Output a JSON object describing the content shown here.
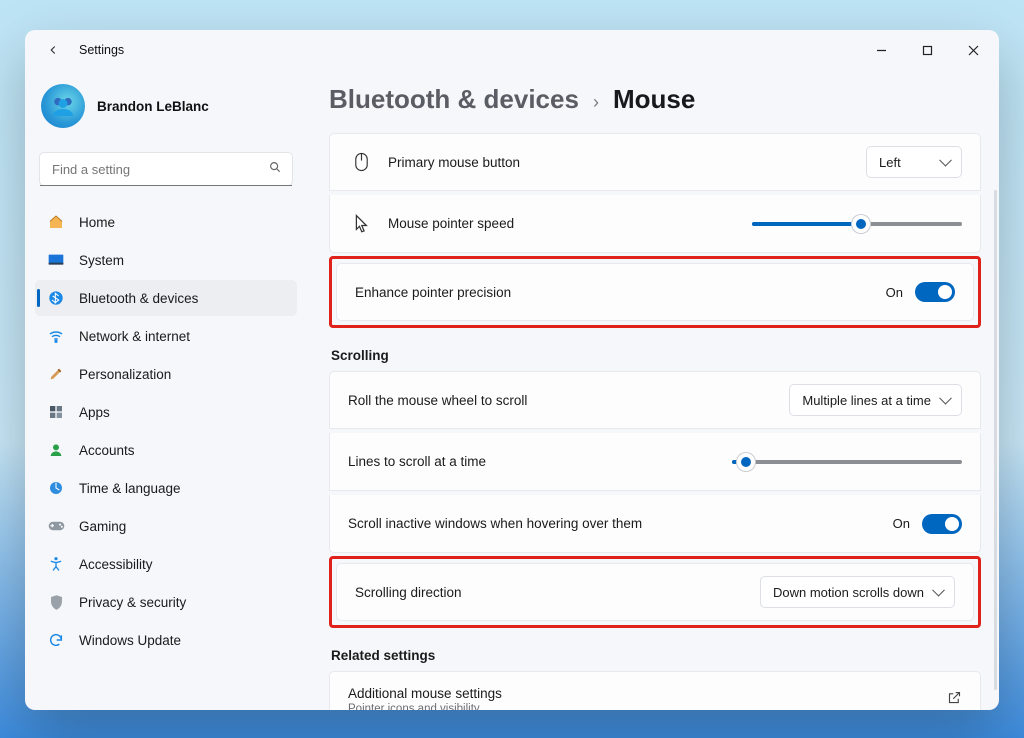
{
  "window": {
    "title": "Settings"
  },
  "account": {
    "name": "Brandon LeBlanc"
  },
  "search": {
    "placeholder": "Find a setting"
  },
  "nav": {
    "home": "Home",
    "system": "System",
    "bluetooth": "Bluetooth & devices",
    "network": "Network & internet",
    "personalization": "Personalization",
    "apps": "Apps",
    "accounts": "Accounts",
    "time": "Time & language",
    "gaming": "Gaming",
    "accessibility": "Accessibility",
    "privacy": "Privacy & security",
    "update": "Windows Update"
  },
  "crumbs": {
    "parent": "Bluetooth & devices",
    "sep": "›",
    "current": "Mouse"
  },
  "settings": {
    "primary_button": {
      "label": "Primary mouse button",
      "value": "Left"
    },
    "pointer_speed": {
      "label": "Mouse pointer speed",
      "value_pct": 52
    },
    "enhance_precision": {
      "label": "Enhance pointer precision",
      "state_text": "On",
      "on": true
    },
    "scrolling_head": "Scrolling",
    "roll_wheel": {
      "label": "Roll the mouse wheel to scroll",
      "value": "Multiple lines at a time"
    },
    "lines": {
      "label": "Lines to scroll at a time",
      "value_pct": 6
    },
    "inactive": {
      "label": "Scroll inactive windows when hovering over them",
      "state_text": "On",
      "on": true
    },
    "direction": {
      "label": "Scrolling direction",
      "value": "Down motion scrolls down"
    },
    "related_head": "Related settings",
    "additional": {
      "label": "Additional mouse settings",
      "sub": "Pointer icons and visibility"
    }
  }
}
